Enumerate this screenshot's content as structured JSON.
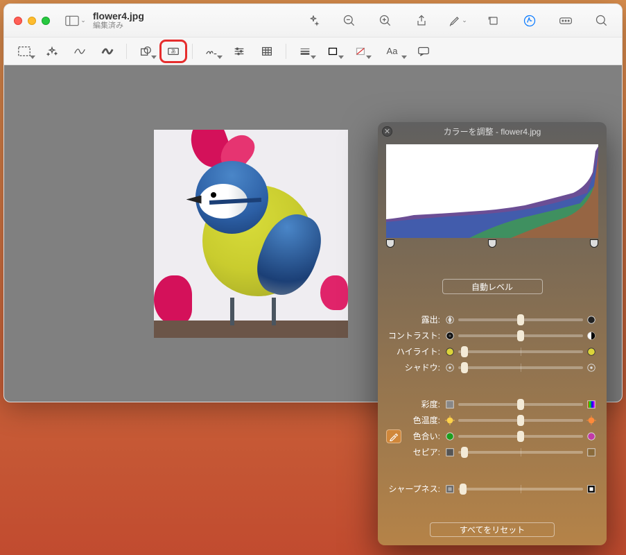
{
  "window": {
    "filename": "flower4.jpg",
    "subtitle": "編集済み"
  },
  "toolbar": {
    "sidebar_icon": "sidebar-icon",
    "top_icons": [
      "sparkle",
      "zoom-out",
      "zoom-in",
      "share",
      "markup",
      "rotate",
      "edit-pencil",
      "info",
      "search"
    ]
  },
  "markup_bar": {
    "g1": [
      "select",
      "instant-alpha",
      "sketch",
      "draw"
    ],
    "g2": [
      "shape",
      "text-box"
    ],
    "g3": [
      "sign",
      "adjust",
      "crop"
    ],
    "g4": [
      "line-style",
      "border-color",
      "fill-color",
      "font",
      "annotate"
    ]
  },
  "panel": {
    "title": "カラーを調整 - flower4.jpg",
    "auto_button": "自動レベル",
    "sliders": [
      {
        "key": "exposure",
        "label": "露出:",
        "pos": 50,
        "icon_left": "aperture-open",
        "icon_right": "aperture-closed"
      },
      {
        "key": "contrast",
        "label": "コントラスト:",
        "pos": 50,
        "icon_left": "contrast-low",
        "icon_right": "contrast-high"
      },
      {
        "key": "highlights",
        "label": "ハイライト:",
        "pos": 5,
        "icon_left": "hl-yellow",
        "icon_right": "hl-yellow"
      },
      {
        "key": "shadows",
        "label": "シャドウ:",
        "pos": 5,
        "icon_left": "sh-dot",
        "icon_right": "sh-dot"
      }
    ],
    "sliders2": [
      {
        "key": "saturation",
        "label": "彩度:",
        "pos": 50,
        "icon_left": "sat-gray",
        "icon_right": "sat-color"
      },
      {
        "key": "temperature",
        "label": "色温度:",
        "pos": 50,
        "icon_left": "temp-cold",
        "icon_right": "temp-hot"
      },
      {
        "key": "tint",
        "label": "色合い:",
        "pos": 50,
        "icon_left": "tint-green",
        "icon_right": "tint-magenta",
        "has_eyedrop": true
      },
      {
        "key": "sepia",
        "label": "セピア:",
        "pos": 5,
        "icon_left": "sepia-off",
        "icon_right": "sepia-on"
      }
    ],
    "sharpness": {
      "label": "シャープネス:",
      "pos": 4,
      "icon_left": "sharp-low",
      "icon_right": "sharp-high"
    },
    "reset_button": "すべてをリセット"
  }
}
